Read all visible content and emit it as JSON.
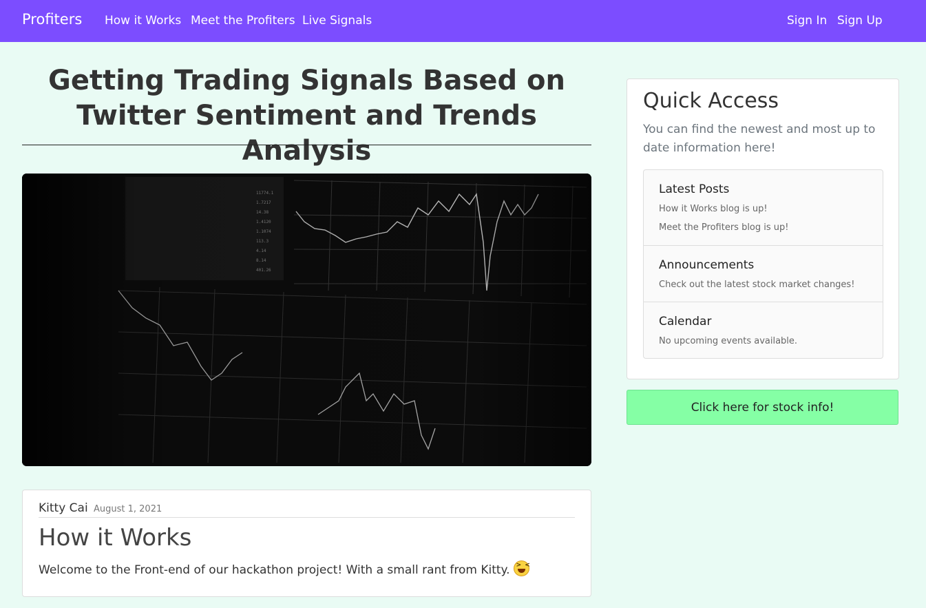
{
  "navbar": {
    "brand": "Profiters",
    "links": [
      "How it Works",
      "Meet the Profiters",
      "Live Signals"
    ],
    "auth": [
      "Sign In",
      "Sign Up"
    ],
    "background_color": "#7c4dff"
  },
  "main": {
    "title": "Getting Trading Signals Based on Twitter Sentiment and Trends Analysis",
    "hero_image_icon": "stock-chart-photo",
    "post": {
      "author": "Kitty Cai",
      "date": "August 1, 2021",
      "title": "How it Works",
      "body": "Welcome to the Front-end of our hackathon project! With a small rant from Kitty.",
      "emoji_icon": "laughing-face-icon"
    }
  },
  "sidebar": {
    "title": "Quick Access",
    "subtitle": "You can find the newest and most up to date information here!",
    "items": [
      {
        "heading": "Latest Posts",
        "lines": [
          "How it Works blog is up!",
          "Meet the Profiters blog is up!"
        ]
      },
      {
        "heading": "Announcements",
        "lines": [
          "Check out the latest stock market changes!"
        ]
      },
      {
        "heading": "Calendar",
        "lines": [
          "No upcoming events available."
        ]
      }
    ],
    "stock_button": "Click here for stock info!",
    "stock_button_color": "#85ffa5"
  }
}
